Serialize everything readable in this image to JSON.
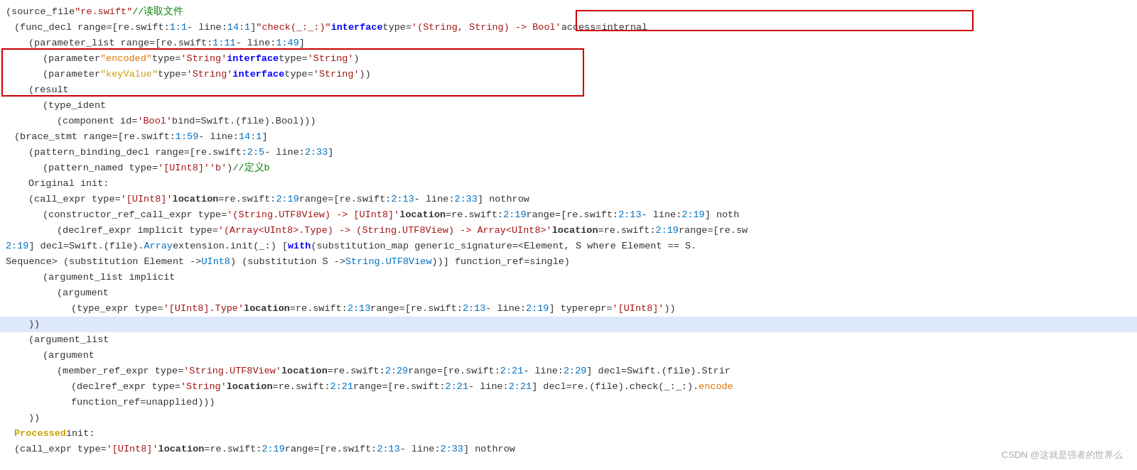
{
  "watermark": "CSDN @这就是强者的世界么",
  "lines": [
    {
      "id": "line1",
      "indent": 0,
      "highlighted": false,
      "content": "(source_file \"re.swift\"   //读取文件"
    },
    {
      "id": "line2",
      "indent": 1,
      "highlighted": false,
      "content": "(func_decl range=[re.swift:1:1 - line:14:1] \"check(_:_:)\" interface type='(String, String) -> Bool' access=internal"
    },
    {
      "id": "line3",
      "indent": 2,
      "highlighted": false,
      "content": "(parameter_list range=[re.swift:1:11 - line:1:49]"
    },
    {
      "id": "line4",
      "indent": 3,
      "highlighted": false,
      "content": "(parameter \"encoded\" type='String' interface type='String')"
    },
    {
      "id": "line5",
      "indent": 3,
      "highlighted": false,
      "content": "(parameter \"keyValue\" type='String' interface type='String'))"
    },
    {
      "id": "line6",
      "indent": 2,
      "highlighted": false,
      "content": "(result"
    },
    {
      "id": "line7",
      "indent": 3,
      "highlighted": false,
      "content": "(type_ident"
    },
    {
      "id": "line8",
      "indent": 4,
      "highlighted": false,
      "content": "(component id='Bool' bind=Swift.(file).Bool)))"
    },
    {
      "id": "line9",
      "indent": 1,
      "highlighted": false,
      "content": "(brace_stmt range=[re.swift:1:59 - line:14:1]"
    },
    {
      "id": "line10",
      "indent": 2,
      "highlighted": false,
      "content": "(pattern_binding_decl range=[re.swift:2:5 - line:2:33]"
    },
    {
      "id": "line11",
      "indent": 3,
      "highlighted": false,
      "content": "(pattern_named type='[UInt8]' 'b')   //定义b"
    },
    {
      "id": "line12",
      "indent": 2,
      "highlighted": false,
      "content": "Original init:"
    },
    {
      "id": "line13",
      "indent": 2,
      "highlighted": false,
      "content": "(call_expr type='[UInt8]' location=re.swift:2:19 range=[re.swift:2:13 - line:2:33] nothrow"
    },
    {
      "id": "line14",
      "indent": 3,
      "highlighted": false,
      "content": "(constructor_ref_call_expr type='(String.UTF8View) -> [UInt8]' location=re.swift:2:19 range=[re.swift:2:13 - line:2:19] noth"
    },
    {
      "id": "line15",
      "indent": 4,
      "highlighted": false,
      "content": "(declref_expr implicit type='(Array<UInt8>.Type) -> (String.UTF8View) -> Array<UInt8>' location=re.swift:2:19 range=[re.sw"
    },
    {
      "id": "line16",
      "indent": 0,
      "highlighted": false,
      "content": "2:19] decl=Swift.(file).Array extension.init(_:) [with (substitution_map generic_signature=<Element, S where Element == S."
    },
    {
      "id": "line17",
      "indent": 0,
      "highlighted": false,
      "content": "Sequence> (substitution Element -> UInt8) (substitution S -> String.UTF8View))] function_ref=single)"
    },
    {
      "id": "line18",
      "indent": 3,
      "highlighted": false,
      "content": "(argument_list implicit"
    },
    {
      "id": "line19",
      "indent": 4,
      "highlighted": false,
      "content": "(argument"
    },
    {
      "id": "line20",
      "indent": 5,
      "highlighted": false,
      "content": "(type_expr type='[UInt8].Type' location=re.swift:2:13 range=[re.swift:2:13 - line:2:19] typerepr='[UInt8]'))"
    },
    {
      "id": "line21",
      "indent": 2,
      "highlighted": true,
      "content": "))"
    },
    {
      "id": "line22",
      "indent": 2,
      "highlighted": false,
      "content": "(argument_list"
    },
    {
      "id": "line23",
      "indent": 3,
      "highlighted": false,
      "content": "(argument"
    },
    {
      "id": "line24",
      "indent": 4,
      "highlighted": false,
      "content": "(member_ref_expr type='String.UTF8View' location=re.swift:2:29 range=[re.swift:2:21 - line:2:29] decl=Swift.(file).Strir"
    },
    {
      "id": "line25",
      "indent": 5,
      "highlighted": false,
      "content": "(declref_expr type='String' location=re.swift:2:21 range=[re.swift:2:21 - line:2:21] decl=re.(file).check(_:_:).encode"
    },
    {
      "id": "line26",
      "indent": 5,
      "highlighted": false,
      "content": "function_ref=unapplied)))"
    },
    {
      "id": "line27",
      "indent": 2,
      "highlighted": false,
      "content": "))"
    },
    {
      "id": "line28",
      "indent": 1,
      "highlighted": false,
      "content": "Processed init:"
    },
    {
      "id": "line29",
      "indent": 1,
      "highlighted": false,
      "content": "(call_expr type='[UInt8]' location=re.swift:2:19 range=[re.swift:2:13 - line:2:33] nothrow"
    }
  ]
}
